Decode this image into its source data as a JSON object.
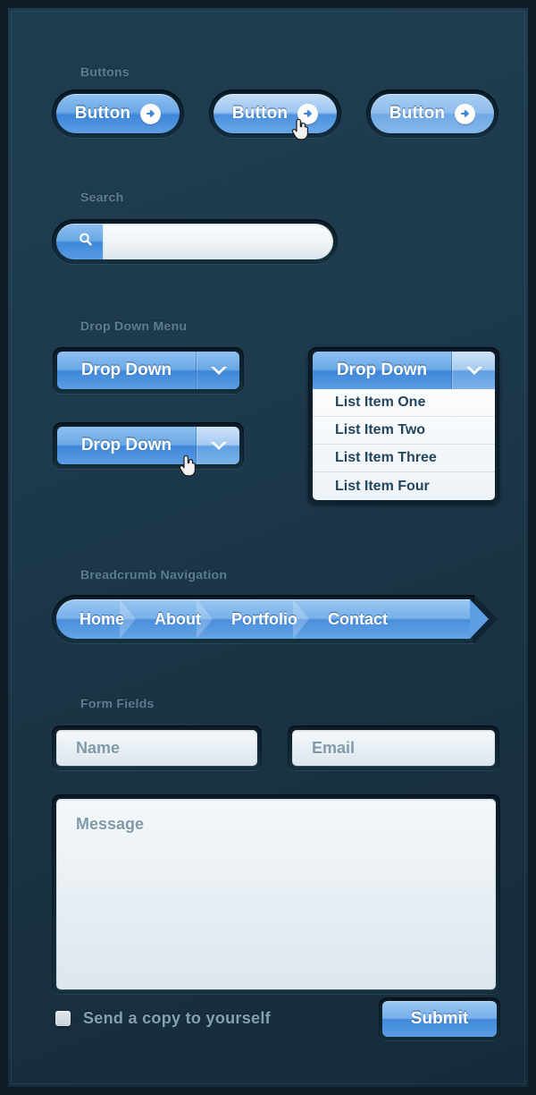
{
  "sections": {
    "buttons_label": "Buttons",
    "search_label": "Search",
    "dropdown_label": "Drop Down Menu",
    "breadcrumb_label": "Breadcrumb Navigation",
    "form_label": "Form Fields"
  },
  "buttons": [
    {
      "label": "Button",
      "state": "normal",
      "icon": "arrow-right-circle-icon"
    },
    {
      "label": "Button",
      "state": "hover",
      "icon": "arrow-right-circle-icon"
    },
    {
      "label": "Button",
      "state": "active",
      "icon": "arrow-right-circle-icon"
    }
  ],
  "search": {
    "icon": "magnifier-icon",
    "value": "",
    "placeholder": ""
  },
  "dropdowns": [
    {
      "label": "Drop Down",
      "state": "normal",
      "icon": "chevron-down-icon"
    },
    {
      "label": "Drop Down",
      "state": "hover",
      "icon": "chevron-down-icon"
    },
    {
      "label": "Drop Down",
      "state": "open",
      "icon": "chevron-down-icon"
    }
  ],
  "dropdown_items": [
    "List Item One",
    "List Item Two",
    "List Item Three",
    "List Item Four"
  ],
  "breadcrumb": [
    "Home",
    "About",
    "Portfolio",
    "Contact"
  ],
  "form": {
    "name": {
      "value": "",
      "placeholder": "Name"
    },
    "email": {
      "value": "",
      "placeholder": "Email"
    },
    "message": {
      "value": "",
      "placeholder": "Message"
    },
    "checkbox_label": "Send a copy to yourself",
    "checkbox_checked": false,
    "submit_label": "Submit"
  },
  "colors": {
    "background": "#1d3a4e",
    "frame": "#0d1c26",
    "accent_blue": "#4a8edb",
    "accent_light": "#9ac8f1",
    "label_text": "#5e7d90",
    "list_text": "#22465e",
    "placeholder": "#7f9aa8"
  }
}
